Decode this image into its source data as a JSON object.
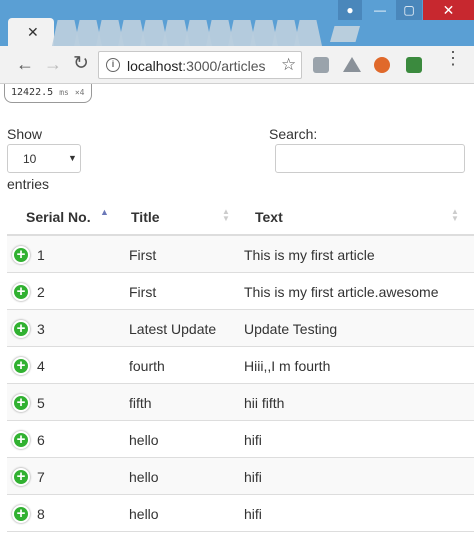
{
  "browser": {
    "url_host": "localhost",
    "url_path": ":3000/articles"
  },
  "perf_badge": {
    "value": "12422.5",
    "unit": "ms",
    "count": "×4"
  },
  "datatable": {
    "show_label": "Show",
    "page_length": "10",
    "entries_label": "entries",
    "search_label": "Search:",
    "search_value": "",
    "columns": [
      "Serial No.",
      "Title",
      "Text"
    ],
    "sorted_column": "Serial No.",
    "rows": [
      {
        "serial": "1",
        "title": "First",
        "text": "This is my first article"
      },
      {
        "serial": "2",
        "title": "First",
        "text": "This is my first article.awesome"
      },
      {
        "serial": "3",
        "title": "Latest Update",
        "text": "Update Testing"
      },
      {
        "serial": "4",
        "title": "fourth",
        "text": "Hiii,,I m fourth"
      },
      {
        "serial": "5",
        "title": "fifth",
        "text": "hii fifth"
      },
      {
        "serial": "6",
        "title": "hello",
        "text": "hifi"
      },
      {
        "serial": "7",
        "title": "hello",
        "text": "hifi"
      },
      {
        "serial": "8",
        "title": "hello",
        "text": "hifi"
      }
    ]
  },
  "icons": {
    "expand_row": "plus-circle-icon",
    "sort_asc": "sort-asc-icon",
    "sort_both": "sort-both-icon"
  },
  "colors": {
    "titlebar": "#5a9fd4",
    "expand_button": "#31b131",
    "sort_active": "#6b78b8",
    "close_button": "#c7282f"
  }
}
